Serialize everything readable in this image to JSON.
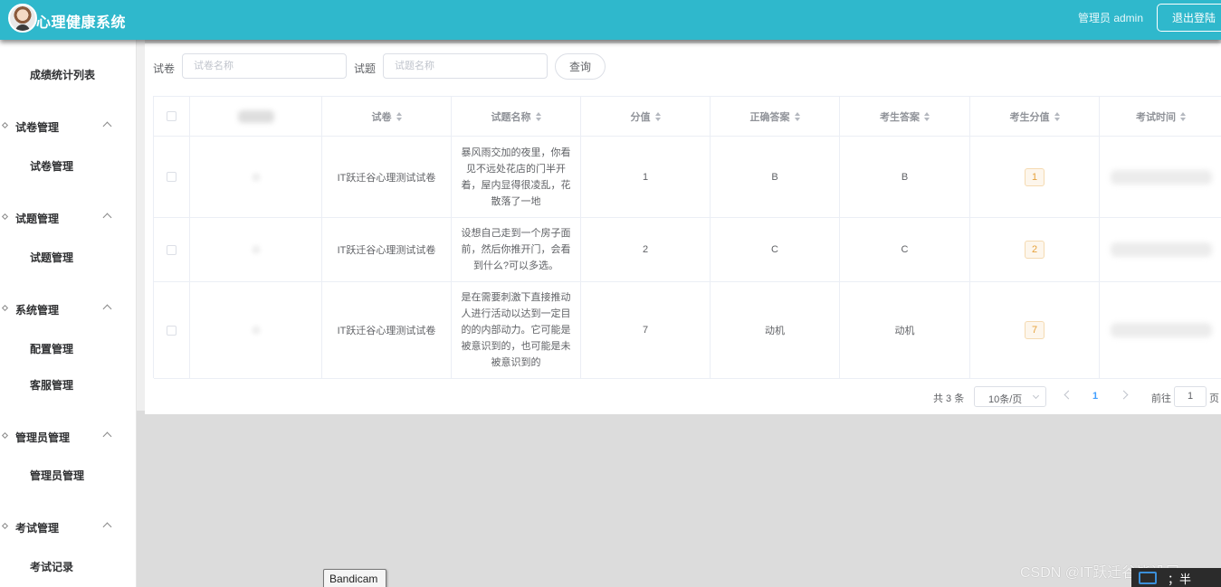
{
  "header": {
    "app_title": "心理健康系统",
    "admin_label": "管理员 admin",
    "logout_label": "退出登陆"
  },
  "sidebar": {
    "top_item": "成绩统计列表",
    "groups": [
      {
        "label": "试卷管理",
        "items": [
          "试卷管理"
        ]
      },
      {
        "label": "试题管理",
        "items": [
          "试题管理"
        ]
      },
      {
        "label": "系统管理",
        "items": [
          "配置管理",
          "客服管理"
        ]
      },
      {
        "label": "管理员管理",
        "items": [
          "管理员管理"
        ]
      },
      {
        "label": "考试管理",
        "items": [
          "考试记录"
        ]
      }
    ]
  },
  "filter": {
    "paper_label": "试卷",
    "paper_placeholder": "试卷名称",
    "question_label": "试题",
    "question_placeholder": "试题名称",
    "query_label": "查询"
  },
  "table": {
    "columns": [
      "试卷",
      "试题名称",
      "分值",
      "正确答案",
      "考生答案",
      "考生分值",
      "考试时间"
    ],
    "rows": [
      {
        "paper": "IT跃迁谷心理测试试卷",
        "question": "暴风雨交加的夜里，你看见不远处花店的门半开着，屋内显得很凌乱，花散落了一地",
        "score": "1",
        "correct": "B",
        "answer": "B",
        "got": "1"
      },
      {
        "paper": "IT跃迁谷心理测试试卷",
        "question": "设想自己走到一个房子面前，然后你推开门，会看到什么?可以多选。",
        "score": "2",
        "correct": "C",
        "answer": "C",
        "got": "2"
      },
      {
        "paper": "IT跃迁谷心理测试试卷",
        "question": "是在需要刺激下直接推动人进行活动以达到一定目的的内部动力。它可能是被意识到的，也可能是未被意识到的",
        "score": "7",
        "correct": "动机",
        "answer": "动机",
        "got": "7"
      }
    ]
  },
  "pagination": {
    "total": "共 3 条",
    "page_size": "10条/页",
    "current": "1",
    "goto": "前往",
    "goto_value": "1",
    "page_unit": "页"
  },
  "overlay": {
    "watermark": "CSDN @IT跃迁谷毕设展",
    "tooltip": "Bandicam",
    "tray_text": "；半"
  }
}
